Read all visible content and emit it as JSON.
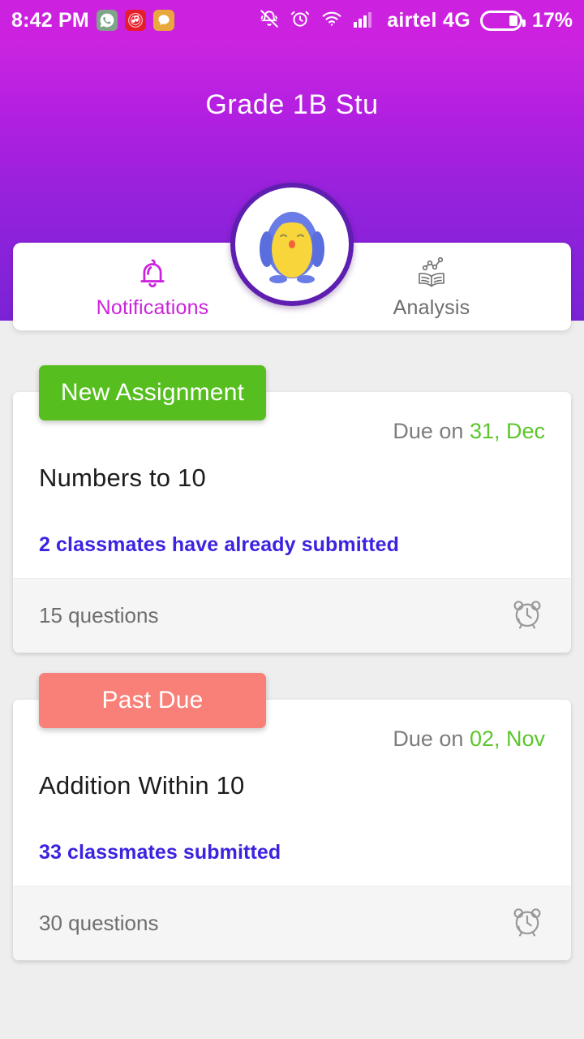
{
  "statusbar": {
    "time": "8:42 PM",
    "app_icons": [
      {
        "name": "whatsapp-icon",
        "glyph": "✆"
      },
      {
        "name": "music-icon",
        "glyph": "♪"
      },
      {
        "name": "chat-icon",
        "glyph": "◗"
      }
    ],
    "icons": [
      "mute-icon",
      "alarm-icon",
      "wifi-icon",
      "signal-icon"
    ],
    "carrier": "airtel 4G",
    "battery_percent": "17%"
  },
  "header": {
    "title": "Grade 1B Stu",
    "avatar": "penguin-avatar",
    "gradient_top": "#cb25e0",
    "gradient_bottom": "#7a23d4"
  },
  "tabs": [
    {
      "label": "Notifications",
      "icon": "bell-icon",
      "active": true,
      "color": "#cc22dd"
    },
    {
      "label": "Analysis",
      "icon": "book-chart-icon",
      "active": false,
      "color": "#6d6d6d"
    }
  ],
  "assignments": [
    {
      "badge": "New Assignment",
      "badge_color": "#56bf1f",
      "due_prefix": "Due on",
      "due_date": "31, Dec",
      "title": "Numbers to 10",
      "submitted_text": "2 classmates have already submitted",
      "questions": "15 questions",
      "footer_icon": "alarm-clock-icon"
    },
    {
      "badge": "Past Due",
      "badge_color": "#f98078",
      "due_prefix": "Due on",
      "due_date": "02, Nov",
      "title": "Addition Within 10",
      "submitted_text": "33 classmates submitted",
      "questions": "30 questions",
      "footer_icon": "alarm-clock-icon"
    }
  ],
  "colors": {
    "background": "#eeeeee",
    "accent_purple": "#cc22dd",
    "due_green": "#5cc62c",
    "link_blue": "#3b23e0"
  }
}
